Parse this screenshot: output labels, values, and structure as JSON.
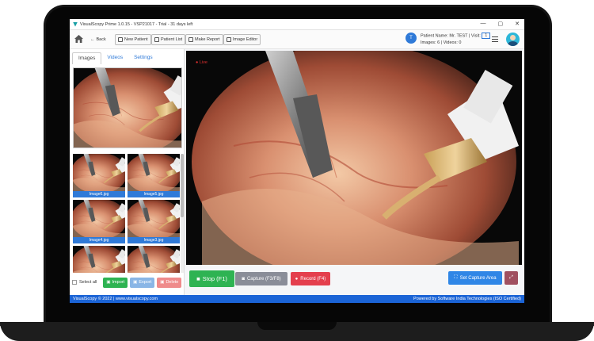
{
  "app": {
    "title": "VisualScopy Prime 1.0.15 - VSP21017 - Trial - 31 days left",
    "window_controls": [
      "—",
      "▢",
      "✕"
    ]
  },
  "toolbar": {
    "back_label": "Back",
    "new_patient_label": "New Patient",
    "patient_list_label": "Patient List",
    "make_report_label": "Make Report",
    "image_editor_label": "Image Editor"
  },
  "patient": {
    "avatar_letter": "T",
    "name_label": "Patient Name:",
    "name_value": "Mr. TEST",
    "visit_label": "Visit:",
    "visit_value": "1",
    "counts": "Images: 6 | Videos: 0"
  },
  "left_panel": {
    "tabs": [
      {
        "label": "Images",
        "active": true
      },
      {
        "label": "Videos",
        "active": false
      },
      {
        "label": "Settings",
        "active": false
      }
    ],
    "thumbnails": [
      {
        "caption": "Image6.jpg"
      },
      {
        "caption": "Image5.jpg"
      },
      {
        "caption": "Image4.jpg"
      },
      {
        "caption": "Image3.jpg"
      },
      {
        "caption": ""
      },
      {
        "caption": ""
      }
    ],
    "select_all_label": "Select all",
    "import_label": "Import",
    "export_label": "Export",
    "delete_label": "Delete"
  },
  "video": {
    "live_label": "Live"
  },
  "controls": {
    "stop_label": "Stop (F1)",
    "capture_label": "Capture (F3/F8)",
    "record_label": "Record (F4)",
    "set_capture_area_label": "Set Capture Area"
  },
  "footer": {
    "left": "VisualScopy © 2022 | www.visualscopy.com",
    "right": "Powered by Software India Technologies (ISO Certified)"
  },
  "colors": {
    "accent": "#1b64d6",
    "stop": "#2eb352",
    "record": "#e43f4d",
    "capture": "#8a8d98"
  }
}
